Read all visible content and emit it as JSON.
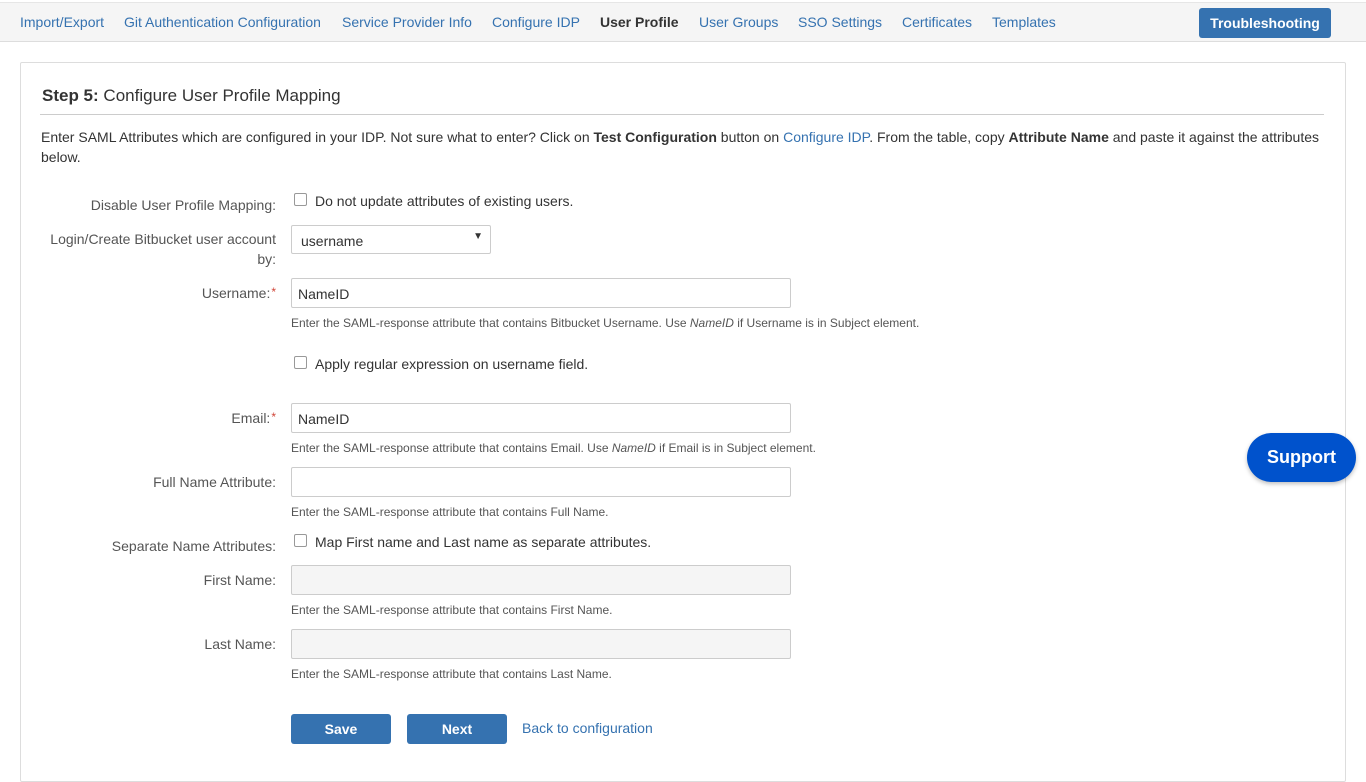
{
  "nav": {
    "tabs": [
      {
        "label": "Import/Export"
      },
      {
        "label": "Git Authentication Configuration"
      },
      {
        "label": "Service Provider Info"
      },
      {
        "label": "Configure IDP"
      },
      {
        "label": "User Profile"
      },
      {
        "label": "User Groups"
      },
      {
        "label": "SSO Settings"
      },
      {
        "label": "Certificates"
      },
      {
        "label": "Templates"
      }
    ],
    "active_tab": "User Profile",
    "troubleshooting_label": "Troubleshooting"
  },
  "header": {
    "step_label": "Step 5:",
    "title": "Configure User Profile Mapping"
  },
  "intro": {
    "part1": "Enter SAML Attributes which are configured in your IDP. Not sure what to enter? Click on ",
    "bold1": "Test Configuration",
    "part2": " button on ",
    "link": "Configure IDP",
    "part3": ". From the table, copy ",
    "bold2": "Attribute Name",
    "part4": " and paste it against the attributes below."
  },
  "form": {
    "disable_mapping": {
      "label": "Disable User Profile Mapping:",
      "checkbox_label": "Do not update attributes of existing users."
    },
    "login_by": {
      "label": "Login/Create Bitbucket user account by:",
      "selected": "username"
    },
    "username": {
      "label": "Username:",
      "required_mark": "*",
      "value": "NameID",
      "help_prefix": "Enter the SAML-response attribute that contains Bitbucket Username. Use ",
      "help_em": "NameID",
      "help_suffix": " if Username is in Subject element."
    },
    "regex": {
      "checkbox_label": "Apply regular expression on username field."
    },
    "email": {
      "label": "Email:",
      "required_mark": "*",
      "value": "NameID",
      "help_prefix": "Enter the SAML-response attribute that contains Email. Use ",
      "help_em": "NameID",
      "help_suffix": " if Email is in Subject element."
    },
    "full_name": {
      "label": "Full Name Attribute:",
      "value": "",
      "help": "Enter the SAML-response attribute that contains Full Name."
    },
    "separate_name": {
      "label": "Separate Name Attributes:",
      "checkbox_label": "Map First name and Last name as separate attributes."
    },
    "first_name": {
      "label": "First Name:",
      "value": "",
      "help": "Enter the SAML-response attribute that contains First Name."
    },
    "last_name": {
      "label": "Last Name:",
      "value": "",
      "help": "Enter the SAML-response attribute that contains Last Name."
    }
  },
  "actions": {
    "save_label": "Save",
    "next_label": "Next",
    "back_label": "Back to configuration"
  },
  "support": {
    "label": "Support"
  },
  "colors": {
    "link": "#3572b0",
    "primary_button": "#3572b0",
    "support_button": "#0052cc",
    "required": "#d04437"
  }
}
